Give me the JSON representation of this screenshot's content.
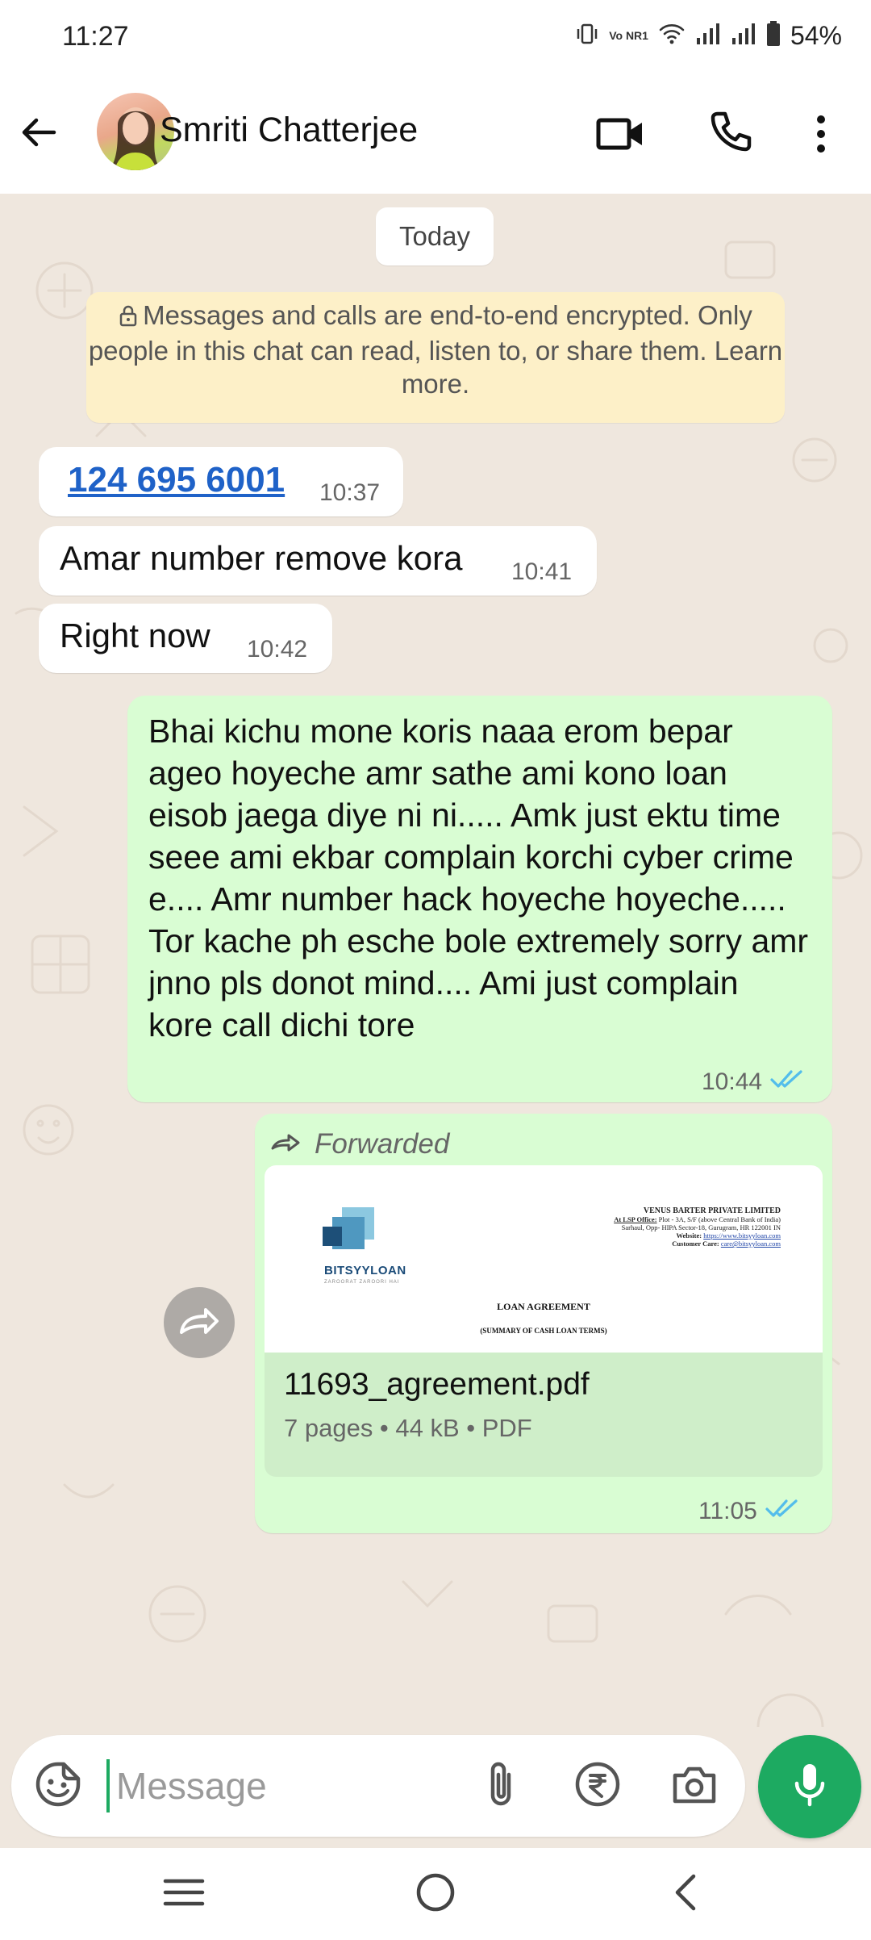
{
  "status_bar": {
    "time": "11:27",
    "network_label": "Vo NR1",
    "battery": "54%",
    "icons": [
      "vibrate-icon",
      "volte-icon",
      "wifi-icon",
      "signal-icon",
      "signal-icon",
      "battery-icon"
    ]
  },
  "header": {
    "contact_name": "Smriti Chatterjee",
    "icons": [
      "back-arrow-icon",
      "video-call-icon",
      "phone-icon",
      "more-vert-icon"
    ]
  },
  "chat": {
    "date_chip": "Today",
    "encryption_notice": "Messages and calls are end-to-end encrypted. Only people in this chat can read, listen to, or share them. Learn more.",
    "messages": [
      {
        "direction": "incoming",
        "text": "124 695 6001",
        "time": "10:37",
        "is_link": true
      },
      {
        "direction": "incoming",
        "text": "Amar number remove kora",
        "time": "10:41"
      },
      {
        "direction": "incoming",
        "text": "Right now",
        "time": "10:42"
      },
      {
        "direction": "outgoing",
        "text": "Bhai kichu mone koris naaa erom bepar ageo hoyeche amr sathe ami kono loan eisob jaega diye ni ni..... Amk just ektu time seee ami ekbar complain korchi cyber crime e.... Amr number hack hoyeche hoyeche..... Tor kache ph esche bole extremely sorry amr jnno pls donot mind.... Ami just complain kore call dichi tore",
        "time": "10:44",
        "status": "read"
      },
      {
        "direction": "outgoing",
        "forwarded_label": "Forwarded",
        "document": {
          "file_name": "11693_agreement.pdf",
          "info": "7 pages • 44 kB • PDF",
          "preview": {
            "brand": "BITSYYLOAN",
            "brand_tagline": "ZAROORAT ZAROORI HAI",
            "company": "VENUS BARTER PRIVATE LIMITED",
            "office_label": "At LSP Office:",
            "office_line1": "Plot - 3A, S/F (above Central Bank of India)",
            "office_line2": "Sarhaul, Opp- HIPA Sector-18, Gurugram, HR 122001 IN",
            "website_label": "Website:",
            "website": "https://www.bitsyyloan.com",
            "care_label": "Customer Care:",
            "care_email": "care@bitsyyloan.com",
            "title": "LOAN AGREEMENT",
            "subtitle": "(SUMMARY OF CASH LOAN TERMS)"
          }
        },
        "time": "11:05",
        "status": "read"
      }
    ]
  },
  "input_bar": {
    "placeholder": "Message",
    "value": "",
    "icons": [
      "emoji-sticker-icon",
      "attach-icon",
      "rupee-payment-icon",
      "camera-icon",
      "microphone-icon"
    ]
  },
  "nav_bar": {
    "icons": [
      "recents-icon",
      "home-icon",
      "back-icon"
    ]
  },
  "colors": {
    "chat_background": "#efe7de",
    "outgoing_bubble": "#d9fdd3",
    "incoming_bubble": "#ffffff",
    "accent_green": "#1daa61",
    "read_tick_blue": "#53bdeb",
    "link_blue": "#1f62c8",
    "encryption_notice_bg": "#fdf0c8"
  }
}
